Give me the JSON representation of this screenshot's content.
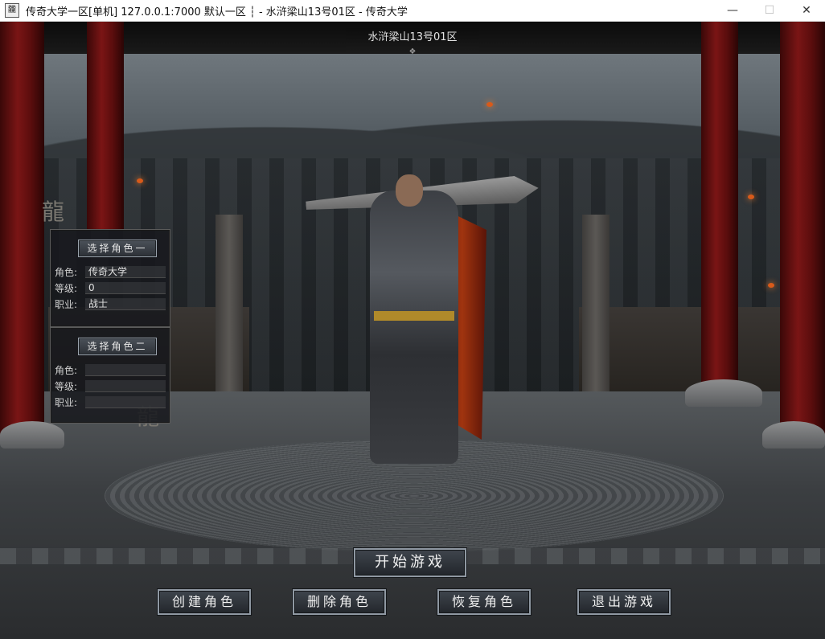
{
  "window": {
    "title": "传奇大学一区[单机] 127.0.0.1:7000  默认一区 ┆ - 水浒梁山13号01区 - 传奇大学",
    "app_icon": "龖",
    "minimize": "—",
    "maximize": "☐",
    "close": "✕"
  },
  "server": {
    "name": "水浒梁山13号01区"
  },
  "slots": [
    {
      "select_label": "选择角色一",
      "fields": [
        {
          "label": "角色:",
          "value": "传奇大学"
        },
        {
          "label": "等级:",
          "value": "0"
        },
        {
          "label": "职业:",
          "value": "战士"
        }
      ]
    },
    {
      "select_label": "选择角色二",
      "fields": [
        {
          "label": "角色:",
          "value": ""
        },
        {
          "label": "等级:",
          "value": ""
        },
        {
          "label": "职业:",
          "value": ""
        }
      ]
    }
  ],
  "actions": {
    "start": "开始游戏",
    "create": "创建角色",
    "delete": "删除角色",
    "restore": "恢复角色",
    "exit": "退出游戏"
  },
  "icons": {
    "dragon": "dragon-ornament-icon"
  }
}
